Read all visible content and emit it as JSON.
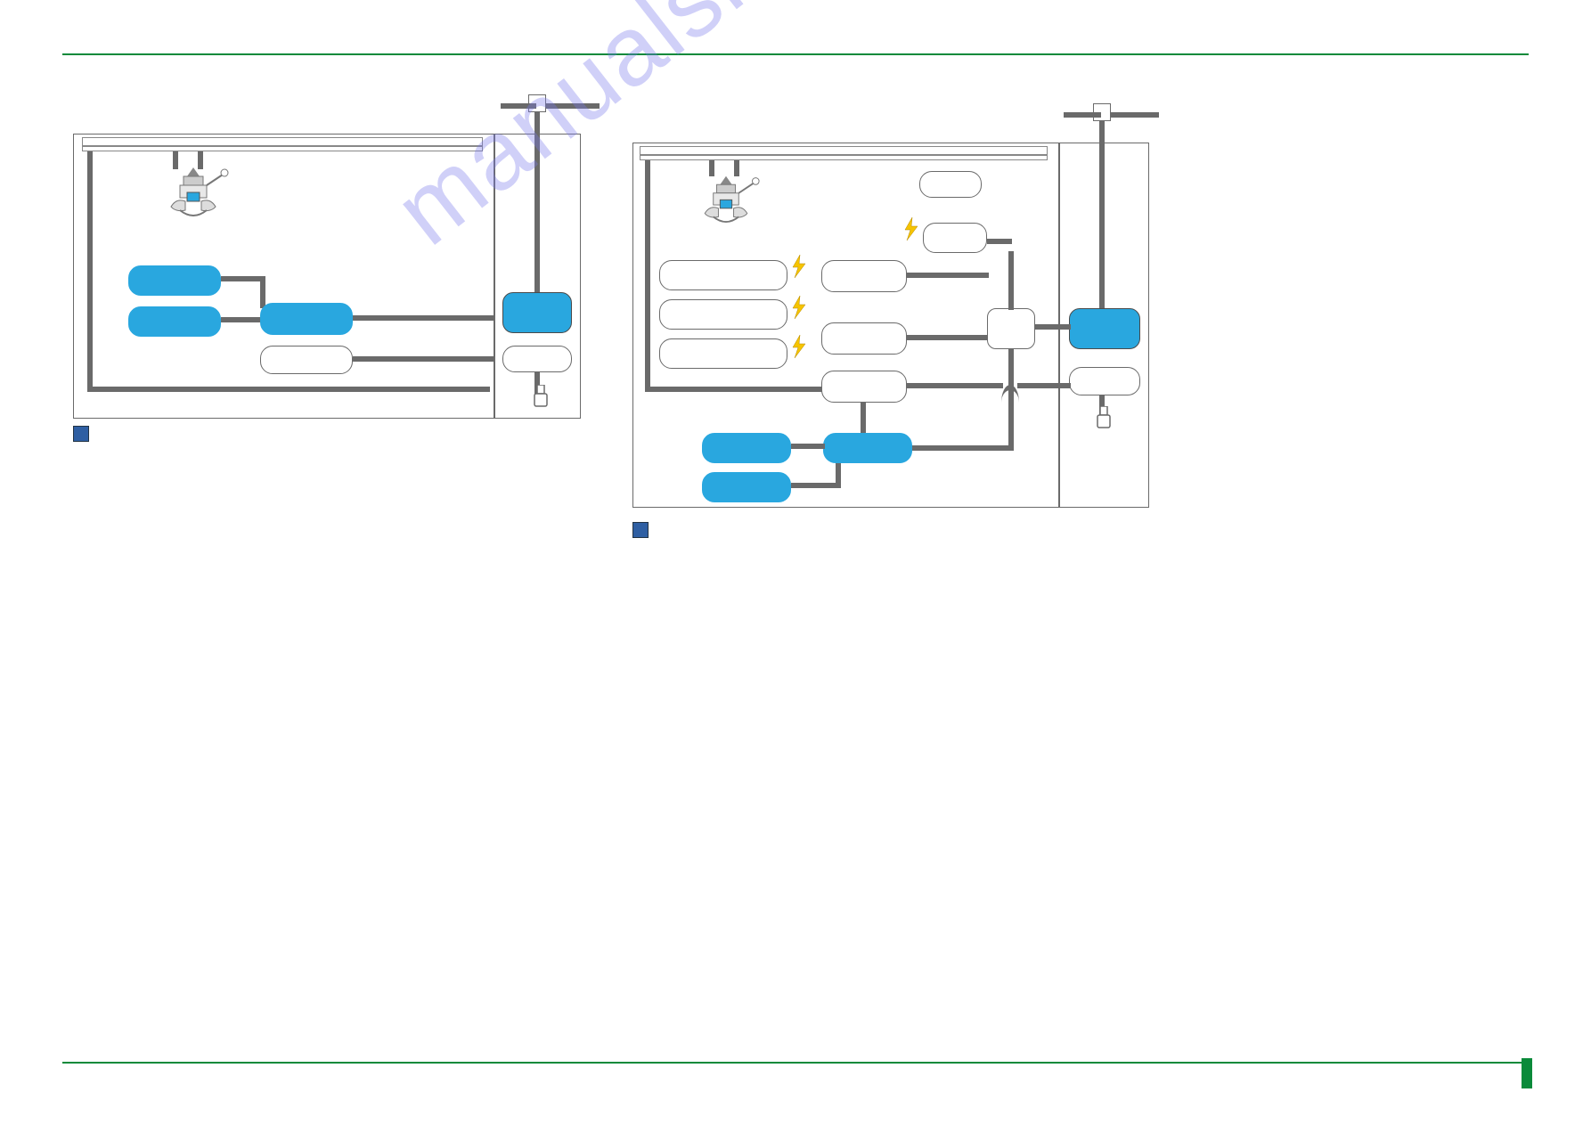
{
  "watermark": "manualshive.com"
}
